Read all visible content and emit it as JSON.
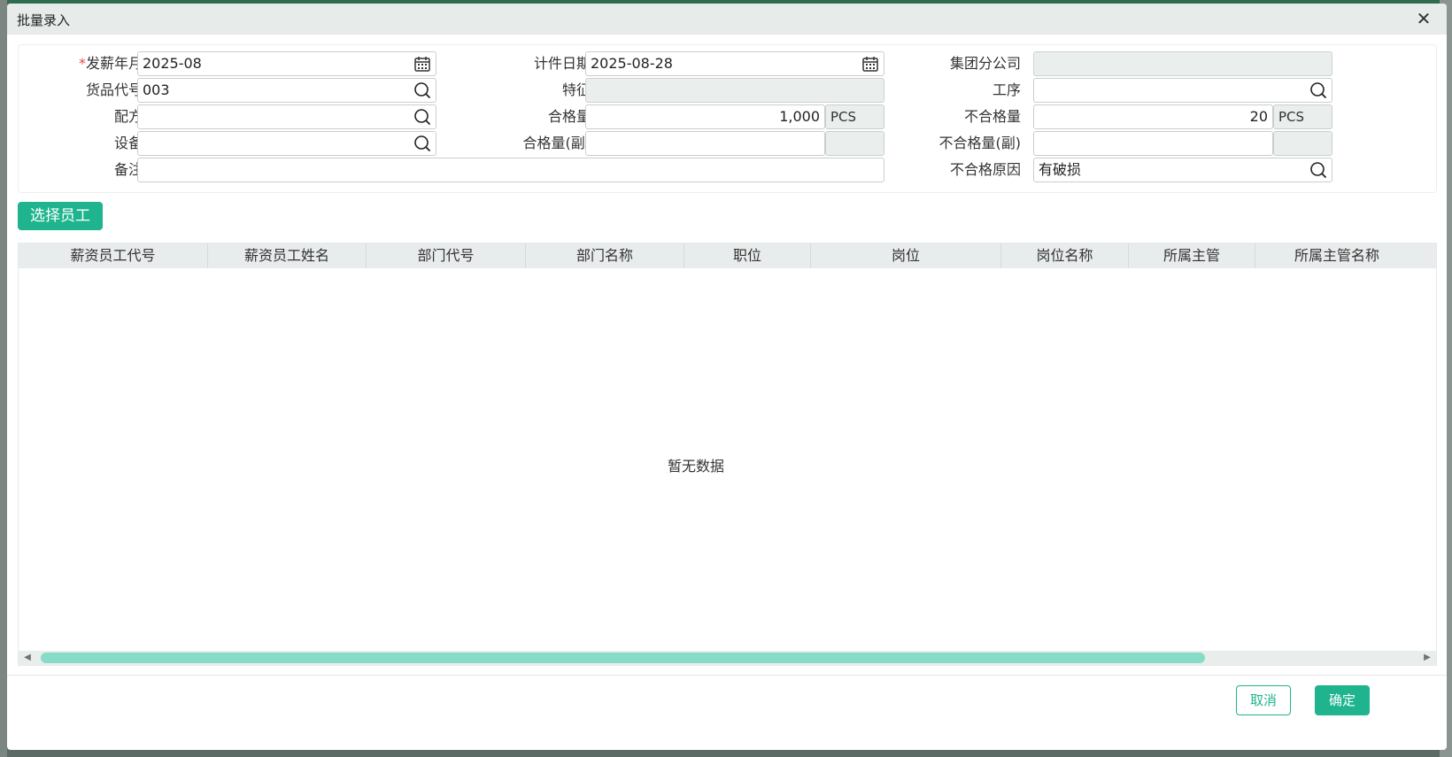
{
  "dialog": {
    "title": "批量录入",
    "close_label": "✕"
  },
  "form": {
    "pay_month": {
      "label": "发薪年月",
      "required_mark": "*",
      "value": "2025-08"
    },
    "count_date": {
      "label": "计件日期",
      "value": "2025-08-28"
    },
    "group_branch": {
      "label": "集团分公司",
      "value": ""
    },
    "product_code": {
      "label": "货品代号",
      "value": "003"
    },
    "feature": {
      "label": "特征",
      "value": ""
    },
    "process": {
      "label": "工序",
      "value": ""
    },
    "formula": {
      "label": "配方",
      "value": ""
    },
    "qualified_qty": {
      "label": "合格量",
      "value": "1,000",
      "unit": "PCS"
    },
    "unqualified_qty": {
      "label": "不合格量",
      "value": "20",
      "unit": "PCS"
    },
    "equipment": {
      "label": "设备",
      "value": ""
    },
    "qualified_qty_secondary": {
      "label": "合格量(副)",
      "value": "",
      "unit": ""
    },
    "unqualified_qty_secondary": {
      "label": "不合格量(副)",
      "value": "",
      "unit": ""
    },
    "remark": {
      "label": "备注",
      "value": ""
    },
    "unqualified_reason": {
      "label": "不合格原因",
      "value": "有破损"
    }
  },
  "select_staff_button": "选择员工",
  "grid": {
    "columns": [
      "薪资员工代号",
      "薪资员工姓名",
      "部门代号",
      "部门名称",
      "职位",
      "岗位",
      "岗位名称",
      "所属主管",
      "所属主管名称"
    ],
    "empty_text": "暂无数据",
    "scroll_left": "◀",
    "scroll_right": "▶"
  },
  "footer": {
    "cancel_label": "取消",
    "ok_label": "确定"
  },
  "colors": {
    "accent": "#1fb48e",
    "required": "#e84a4a",
    "scroll_thumb": "#86dcc6"
  },
  "icons": {
    "calendar": "calendar-icon",
    "search": "search-icon",
    "close": "close-icon"
  }
}
